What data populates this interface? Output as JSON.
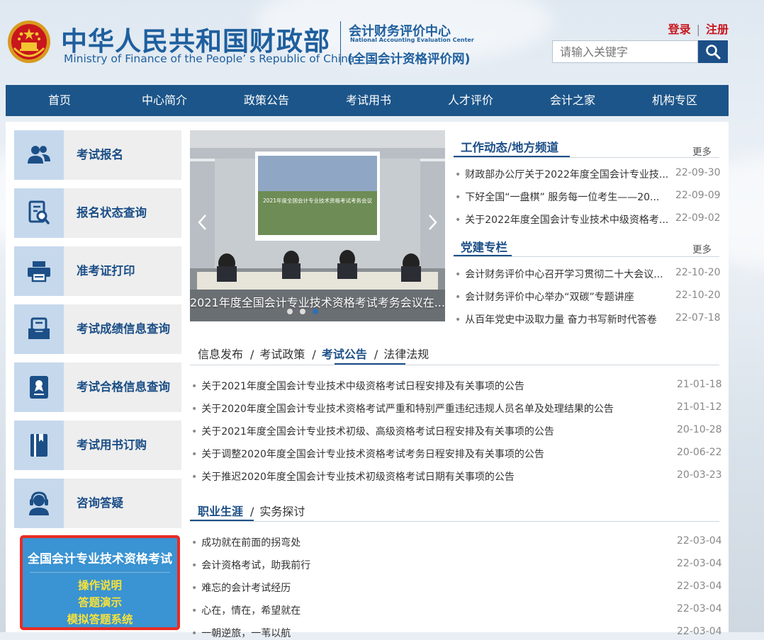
{
  "header": {
    "title_cn": "中华人民共和国财政部",
    "title_en": "Ministry of Finance of the People’ s Republic of China",
    "center_cn": "会计财务评价中心",
    "center_en": "National Accounting Evaluation Center",
    "center_net": "(全国会计资格评价网)",
    "login": "登录",
    "register": "注册",
    "search_placeholder": "请输入关键字"
  },
  "nav": [
    "首页",
    "中心简介",
    "政策公告",
    "考试用书",
    "人才评价",
    "会计之家",
    "机构专区"
  ],
  "sidebar": {
    "items": [
      {
        "label": "考试报名",
        "icon": "users-icon"
      },
      {
        "label": "报名状态查询",
        "icon": "document-search-icon"
      },
      {
        "label": "准考证打印",
        "icon": "printer-icon"
      },
      {
        "label": "考试成绩信息查询",
        "icon": "score-inbox-icon"
      },
      {
        "label": "考试合格信息查询",
        "icon": "certificate-icon"
      },
      {
        "label": "考试用书订购",
        "icon": "book-icon"
      },
      {
        "label": "咨询答疑",
        "icon": "headset-user-icon"
      }
    ],
    "exam_box": {
      "title": "全国会计专业技术资格考试",
      "links": [
        "操作说明",
        "答题演示",
        "模拟答题系统"
      ]
    }
  },
  "carousel": {
    "caption": "2021年度全国会计专业技术资格考试考务会议在...",
    "screen_text": "2021年度全国会计专业技术资格考试考务会议",
    "slide_count": 3,
    "active_slide": 3
  },
  "work_news": {
    "title": "工作动态/地方频道",
    "more": "更多",
    "items": [
      {
        "text": "财政部办公厅关于2022年度全国会计专业技...",
        "date": "22-09-30"
      },
      {
        "text": "下好全国“一盘棋” 服务每一位考生——20...",
        "date": "22-09-09"
      },
      {
        "text": "关于2022年度全国会计专业技术中级资格考...",
        "date": "22-09-02"
      }
    ]
  },
  "party_news": {
    "title": "党建专栏",
    "more": "更多",
    "items": [
      {
        "text": "会计财务评价中心召开学习贯彻二十大会议...",
        "date": "22-10-20"
      },
      {
        "text": "会计财务评价中心举办“双碳”专题讲座",
        "date": "22-10-20"
      },
      {
        "text": "从百年党史中汲取力量 奋力书写新时代答卷",
        "date": "22-07-18"
      }
    ]
  },
  "announce": {
    "tabs": [
      "信息发布",
      "考试政策",
      "考试公告",
      "法律法规"
    ],
    "active_tab": 2,
    "items": [
      {
        "text": "关于2021年度全国会计专业技术中级资格考试日程安排及有关事项的公告",
        "date": "21-01-18"
      },
      {
        "text": "关于2020年度全国会计专业技术资格考试严重和特别严重违纪违规人员名单及处理结果的公告",
        "date": "21-01-12"
      },
      {
        "text": "关于2021年度全国会计专业技术初级、高级资格考试日程安排及有关事项的公告",
        "date": "20-10-28"
      },
      {
        "text": "关于调整2020年度全国会计专业技术资格考试考务日程安排及有关事项的公告",
        "date": "20-06-22"
      },
      {
        "text": "关于推迟2020年度全国会计专业技术初级资格考试日期有关事项的公告",
        "date": "20-03-23"
      }
    ]
  },
  "career": {
    "tabs": [
      "职业生涯",
      "实务探讨"
    ],
    "active_tab": 0,
    "items": [
      {
        "text": "成功就在前面的拐弯处",
        "date": "22-03-04"
      },
      {
        "text": "会计资格考试，助我前行",
        "date": "22-03-04"
      },
      {
        "text": "难忘的会计考试经历",
        "date": "22-03-04"
      },
      {
        "text": "心在，情在，希望就在",
        "date": "22-03-04"
      },
      {
        "text": "一朝逆旅，一苇以航",
        "date": "22-03-04"
      }
    ]
  },
  "colors": {
    "brand_blue": "#1c4f87",
    "nav_blue": "#1c5589",
    "login_red": "#c8161d",
    "exam_box_blue": "#3a93d2",
    "exam_box_border": "#e82b24",
    "exam_link_yellow": "#f7e23a"
  }
}
